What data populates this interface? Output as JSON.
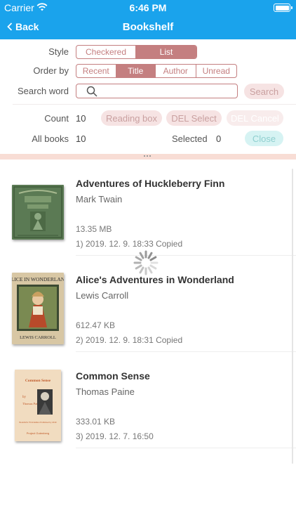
{
  "status_bar": {
    "carrier": "Carrier",
    "time": "6:46 PM"
  },
  "nav": {
    "back_label": "Back",
    "title": "Bookshelf"
  },
  "controls": {
    "style_label": "Style",
    "style_options": [
      "Checkered",
      "List"
    ],
    "style_selected": "List",
    "order_label": "Order by",
    "order_options": [
      "Recent",
      "Title",
      "Author",
      "Unread"
    ],
    "order_selected": "Title",
    "search_label": "Search word",
    "search_value": "",
    "search_button": "Search"
  },
  "stats": {
    "count_label": "Count",
    "count_value": "10",
    "all_books_label": "All books",
    "all_books_value": "10",
    "selected_label": "Selected",
    "selected_value": "0",
    "reading_box_button": "Reading box",
    "del_select_button": "DEL Select",
    "del_cancel_button": "DEL Cancel",
    "close_button": "Close"
  },
  "books": [
    {
      "title": "Adventures of Huckleberry Finn",
      "author": "Mark Twain",
      "size": "13.35 MB",
      "date_line": "1) 2019. 12. 9.  18:33  Copied",
      "cover_colors": [
        "#5b7a54",
        "#3f5a3a"
      ]
    },
    {
      "title": "Alice's Adventures in Wonderland",
      "author": "Lewis Carroll",
      "size": "612.47 KB",
      "date_line": "2) 2019. 12. 9.  18:31  Copied",
      "cover_colors": [
        "#d8c7a4",
        "#b84a2a"
      ]
    },
    {
      "title": "Common Sense",
      "author": "Thomas Paine",
      "size": "333.01 KB",
      "date_line": "3) 2019. 12. 7.  16:50",
      "cover_colors": [
        "#f1dcc0",
        "#c05a2a"
      ]
    }
  ],
  "cover_text": {
    "alice_top": "ALICE IN WONDERLAND",
    "alice_bottom": "LEWIS CARROLL",
    "cs_title": "Common Sense",
    "cs_by": "by",
    "cs_author": "Thomas Paine",
    "cs_edition": "Bookfish's Third Edition Published by 2019",
    "cs_publisher": "Project Gutenberg"
  },
  "colors": {
    "nav_bg": "#1aa3ec",
    "accent": "#c47f80",
    "pill_pink": "#f6e3e3",
    "pill_cyan": "#d6f3f3"
  }
}
